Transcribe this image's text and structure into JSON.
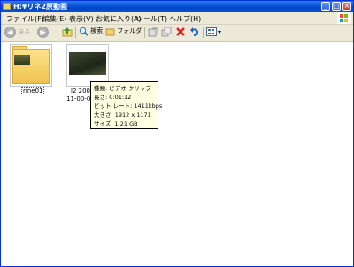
{
  "window": {
    "title": "H:¥リネ2原動画"
  },
  "menu": [
    "ファイル(F)",
    "編集(E)",
    "表示(V)",
    "お気に入り(A)",
    "ツール(T)",
    "ヘルプ(H)"
  ],
  "toolbar": {
    "back": "戻る",
    "forward": "",
    "search": "検索",
    "folders": "フォルダ"
  },
  "items": [
    {
      "name": "rine01",
      "type": "folder"
    },
    {
      "name_line1": "l2 2009-",
      "name_line2": "11-00-02",
      "type": "video"
    }
  ],
  "tooltip": {
    "type": "種類: ビデオ クリップ",
    "length": "長さ: 0:01:12",
    "bitrate": "ビット レート: 1411kbps",
    "dimensions": "大きさ: 1912 x 1171",
    "size": "サイズ: 1.21 GB"
  }
}
